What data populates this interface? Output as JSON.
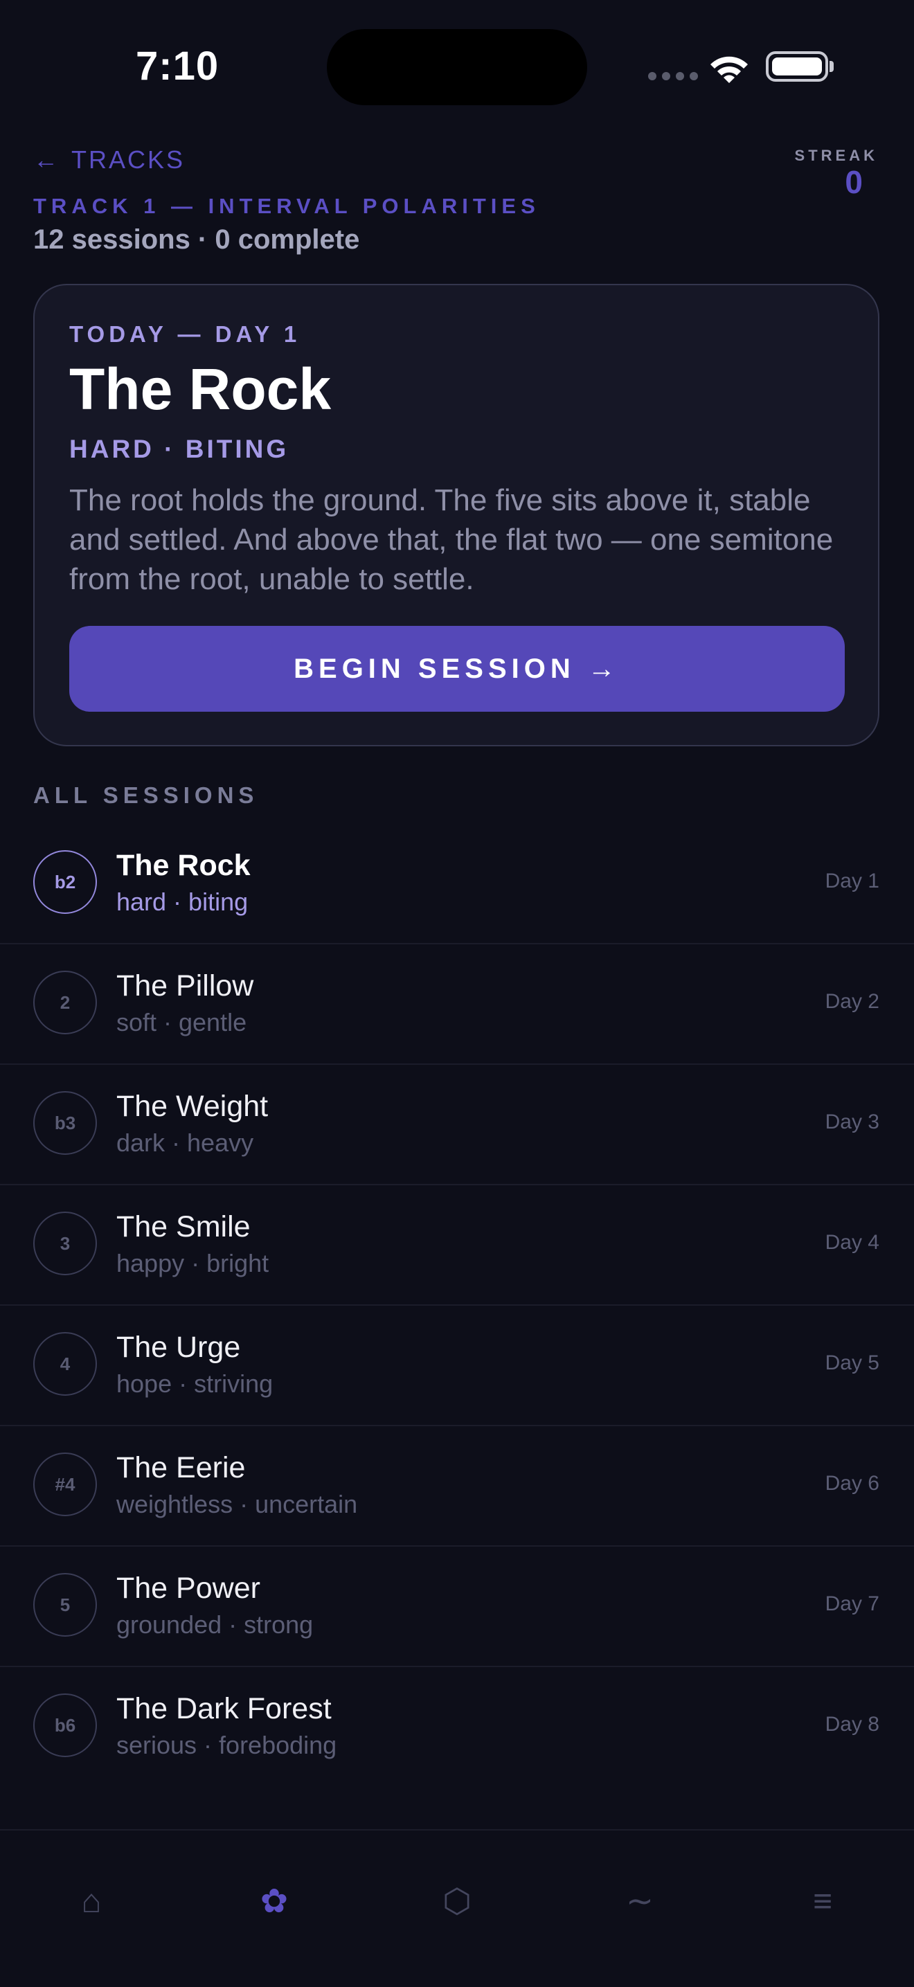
{
  "status_bar": {
    "time": "7:10"
  },
  "header": {
    "back_label": "TRACKS",
    "back_arrow": "←",
    "streak_label": "STREAK",
    "streak_value": "0",
    "track_title": "TRACK 1 — INTERVAL POLARITIES",
    "track_meta": "12 sessions · 0 complete"
  },
  "today": {
    "eyebrow": "TODAY — DAY 1",
    "title": "The Rock",
    "tags": "HARD · BITING",
    "description": "The root holds the ground. The five sits above it, stable and settled. And above that, the flat two — one semitone from the root, unable to settle.",
    "button_label": "BEGIN SESSION →"
  },
  "all_sessions": {
    "label": "ALL SESSIONS",
    "items": [
      {
        "badge": "b2",
        "title": "The Rock",
        "subtitle": "hard · biting",
        "day": "Day 1"
      },
      {
        "badge": "2",
        "title": "The Pillow",
        "subtitle": "soft · gentle",
        "day": "Day 2"
      },
      {
        "badge": "b3",
        "title": "The Weight",
        "subtitle": "dark · heavy",
        "day": "Day 3"
      },
      {
        "badge": "3",
        "title": "The Smile",
        "subtitle": "happy · bright",
        "day": "Day 4"
      },
      {
        "badge": "4",
        "title": "The Urge",
        "subtitle": "hope · striving",
        "day": "Day 5"
      },
      {
        "badge": "#4",
        "title": "The Eerie",
        "subtitle": "weightless · uncertain",
        "day": "Day 6"
      },
      {
        "badge": "5",
        "title": "The Power",
        "subtitle": "grounded · strong",
        "day": "Day 7"
      },
      {
        "badge": "b6",
        "title": "The Dark Forest",
        "subtitle": "serious · foreboding",
        "day": "Day 8"
      }
    ]
  },
  "bottom_nav": {
    "items": [
      {
        "icon": "home-icon",
        "glyph": "⌂"
      },
      {
        "icon": "flower-icon",
        "glyph": "✿"
      },
      {
        "icon": "hexagon-icon",
        "glyph": "⬡"
      },
      {
        "icon": "wave-icon",
        "glyph": "∼"
      },
      {
        "icon": "menu-icon",
        "glyph": "≡"
      }
    ]
  },
  "colors": {
    "background": "#0d0e19",
    "accent": "#5b4fc4",
    "accent_light": "#a59ae6",
    "button": "#5548b8",
    "card": "#161726"
  }
}
